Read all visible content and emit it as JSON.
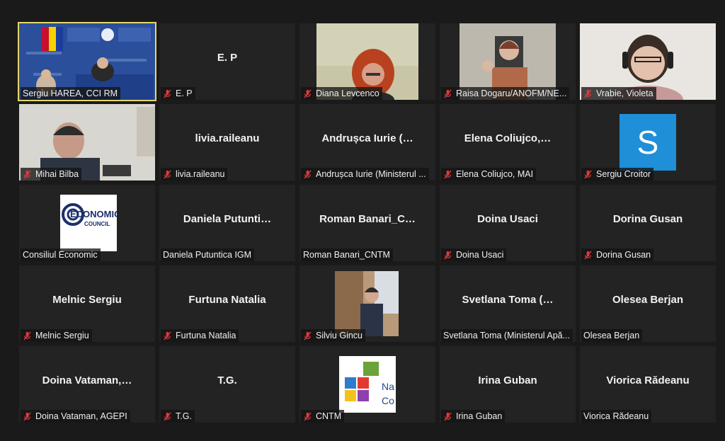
{
  "participants": [
    {
      "label": "Sergiu HAREA, CCI RM",
      "muted": false
    },
    {
      "label": "E. P",
      "center": "E. P",
      "muted": true
    },
    {
      "label": "Diana Levcenco",
      "muted": true
    },
    {
      "label": "Raisa Dogaru/ANOFM/NE...",
      "muted": true
    },
    {
      "label": "Vrabie, Violeta",
      "muted": true
    },
    {
      "label": "Mihai Bilba",
      "muted": true
    },
    {
      "label": "livia.raileanu",
      "center": "livia.raileanu",
      "muted": true
    },
    {
      "label": "Andrușca Iurie (Ministerul ...",
      "center": "Andrușca Iurie (…",
      "muted": true
    },
    {
      "label": "Elena Coliujco, MAI",
      "center": "Elena  Coliujco,…",
      "muted": true
    },
    {
      "label": "Sergiu Croitor",
      "avatar": "S",
      "muted": true
    },
    {
      "label": "Consiliul Economic",
      "logo_text": "ECONOMIC",
      "logo_sub": "COUNCIL",
      "muted": false
    },
    {
      "label": "Daniela Putuntica IGM",
      "center": "Daniela  Putunti…",
      "muted": false
    },
    {
      "label": "Roman Banari_CNTM",
      "center": "Roman  Banari_C…",
      "muted": false
    },
    {
      "label": "Doina Usaci",
      "center": "Doina Usaci",
      "muted": true
    },
    {
      "label": "Dorina Gusan",
      "center": "Dorina Gusan",
      "muted": true
    },
    {
      "label": "Melnic Sergiu",
      "center": "Melnic Sergiu",
      "muted": true
    },
    {
      "label": "Furtuna Natalia",
      "center": "Furtuna Natalia",
      "muted": true
    },
    {
      "label": "Silviu Gincu",
      "muted": true
    },
    {
      "label": "Svetlana Toma (Ministerul Apă...",
      "center": "Svetlana Toma (…",
      "muted": false
    },
    {
      "label": "Olesea Berjan",
      "center": "Olesea Berjan",
      "muted": false
    },
    {
      "label": "Doina Vataman, AGEPI",
      "center": "Doina  Vataman,…",
      "muted": true
    },
    {
      "label": "T.G.",
      "center": "T.G.",
      "muted": true
    },
    {
      "label": "CNTM",
      "logo_text": "Na",
      "logo_sub": "Co",
      "muted": true
    },
    {
      "label": "Irina Guban",
      "center": "Irina Guban",
      "muted": true
    },
    {
      "label": "Viorica Rădeanu",
      "center": "Viorica Rădeanu",
      "muted": false
    }
  ],
  "colors": {
    "background": "#1a1a1a",
    "tile": "#232323",
    "active_border": "#e6d66a",
    "mute_icon": "#e0393e"
  },
  "icons": {
    "mute": "microphone-muted-icon"
  }
}
